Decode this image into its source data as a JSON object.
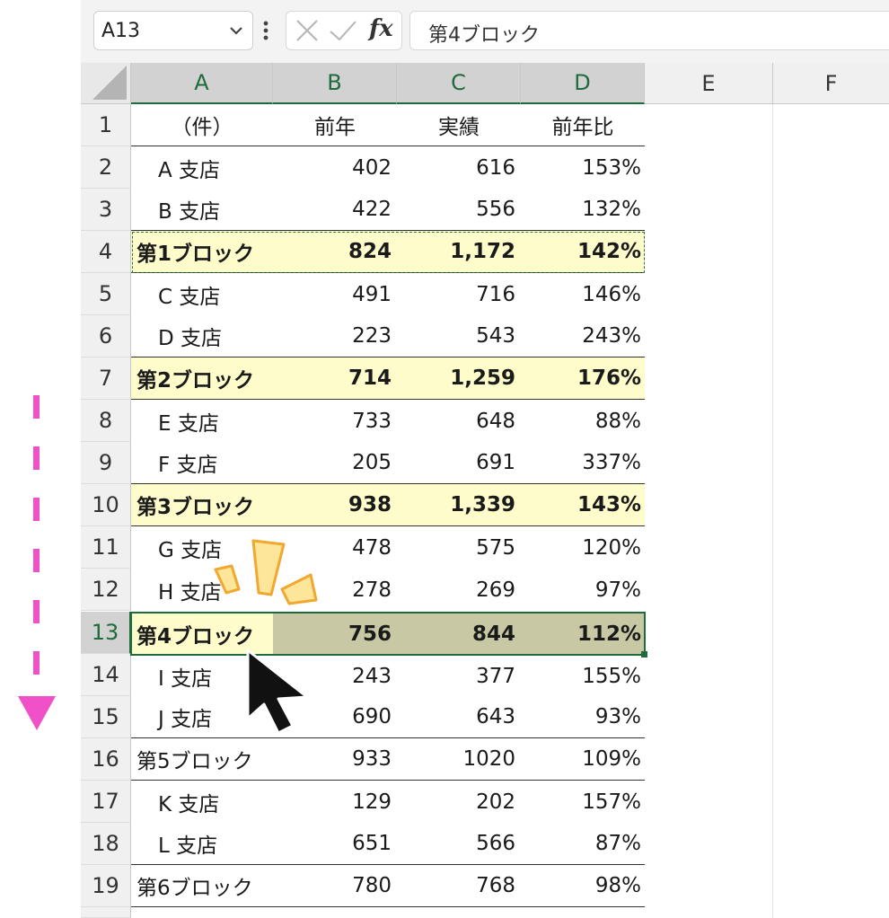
{
  "formula_bar": {
    "name_box": "A13",
    "name_box_chevron": "chevron-down-icon",
    "more_icon": "vertical-ellipsis-icon",
    "cancel_icon": "cancel-x-icon",
    "enter_icon": "checkmark-icon",
    "fx_label": "fx",
    "content": "第4ブロック"
  },
  "columns": [
    "A",
    "B",
    "C",
    "D",
    "E",
    "F"
  ],
  "selected_column_headers": [
    "A",
    "B",
    "C",
    "D"
  ],
  "selected_row": "13",
  "rows": [
    {
      "num": "1",
      "a": "（件）",
      "b": "前年",
      "c": "実績",
      "d": "前年比"
    },
    {
      "num": "2",
      "a": "A 支店",
      "b": "402",
      "c": "616",
      "d": "153%"
    },
    {
      "num": "3",
      "a": "B 支店",
      "b": "422",
      "c": "556",
      "d": "132%"
    },
    {
      "num": "4",
      "a": "第1ブロック",
      "b": "824",
      "c": "1,172",
      "d": "142%"
    },
    {
      "num": "5",
      "a": "C 支店",
      "b": "491",
      "c": "716",
      "d": "146%"
    },
    {
      "num": "6",
      "a": "D 支店",
      "b": "223",
      "c": "543",
      "d": "243%"
    },
    {
      "num": "7",
      "a": "第2ブロック",
      "b": "714",
      "c": "1,259",
      "d": "176%"
    },
    {
      "num": "8",
      "a": "E 支店",
      "b": "733",
      "c": "648",
      "d": "88%"
    },
    {
      "num": "9",
      "a": "F 支店",
      "b": "205",
      "c": "691",
      "d": "337%"
    },
    {
      "num": "10",
      "a": "第3ブロック",
      "b": "938",
      "c": "1,339",
      "d": "143%"
    },
    {
      "num": "11",
      "a": "G 支店",
      "b": "478",
      "c": "575",
      "d": "120%"
    },
    {
      "num": "12",
      "a": "H 支店",
      "b": "278",
      "c": "269",
      "d": "97%"
    },
    {
      "num": "13",
      "a": "第4ブロック",
      "b": "756",
      "c": "844",
      "d": "112%"
    },
    {
      "num": "14",
      "a": "I 支店",
      "b": "243",
      "c": "377",
      "d": "155%"
    },
    {
      "num": "15",
      "a": "J 支店",
      "b": "690",
      "c": "643",
      "d": "93%"
    },
    {
      "num": "16",
      "a": "第5ブロック",
      "b": "933",
      "c": "1020",
      "d": "109%"
    },
    {
      "num": "17",
      "a": "K 支店",
      "b": "129",
      "c": "202",
      "d": "157%"
    },
    {
      "num": "18",
      "a": "L 支店",
      "b": "651",
      "c": "566",
      "d": "87%"
    },
    {
      "num": "19",
      "a": "第6ブロック",
      "b": "780",
      "c": "768",
      "d": "98%"
    }
  ],
  "colors": {
    "block_highlight": "#fffccc",
    "selection_fill": "#c8c8a4",
    "selection_border": "#1e6b3b",
    "arrow_magenta": "#f050c8",
    "sparkle_yellow": "#fde59a",
    "sparkle_orange": "#f0a830"
  },
  "annotations": {
    "down_arrow": "dashed-down-arrow-icon",
    "sparkle": "sparkle-icon",
    "mouse_cursor": "mouse-pointer-icon"
  }
}
